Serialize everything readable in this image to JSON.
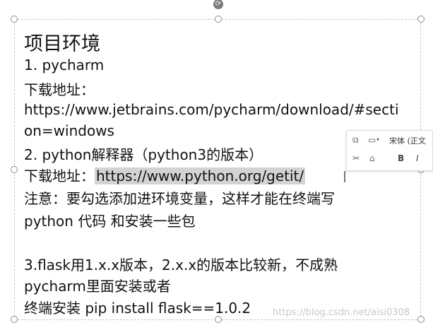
{
  "slide": {
    "title": "项目环境",
    "lines": [
      "1. pycharm",
      "下载地址：",
      "https://www.jetbrains.com/pycharm/download/#secti",
      "on=windows",
      "2. python解释器（python3的版本）",
      "注意：要勾选添加进环境变量，这样才能在终端写",
      "python 代码 和安装一些包",
      "3.flask用1.x.x版本，2.x.x的版本比较新，不成熟",
      "pycharm里面安装或者",
      "终端安装 pip install flask==1.0.2"
    ],
    "download_label": "下载地址：",
    "python_link": "https://www.python.org/getit/"
  },
  "toolbar": {
    "font_name": "宋体 (正文",
    "bold": "B",
    "italic": "I"
  },
  "watermark": "https://blog.csdn.net/aisi0308"
}
